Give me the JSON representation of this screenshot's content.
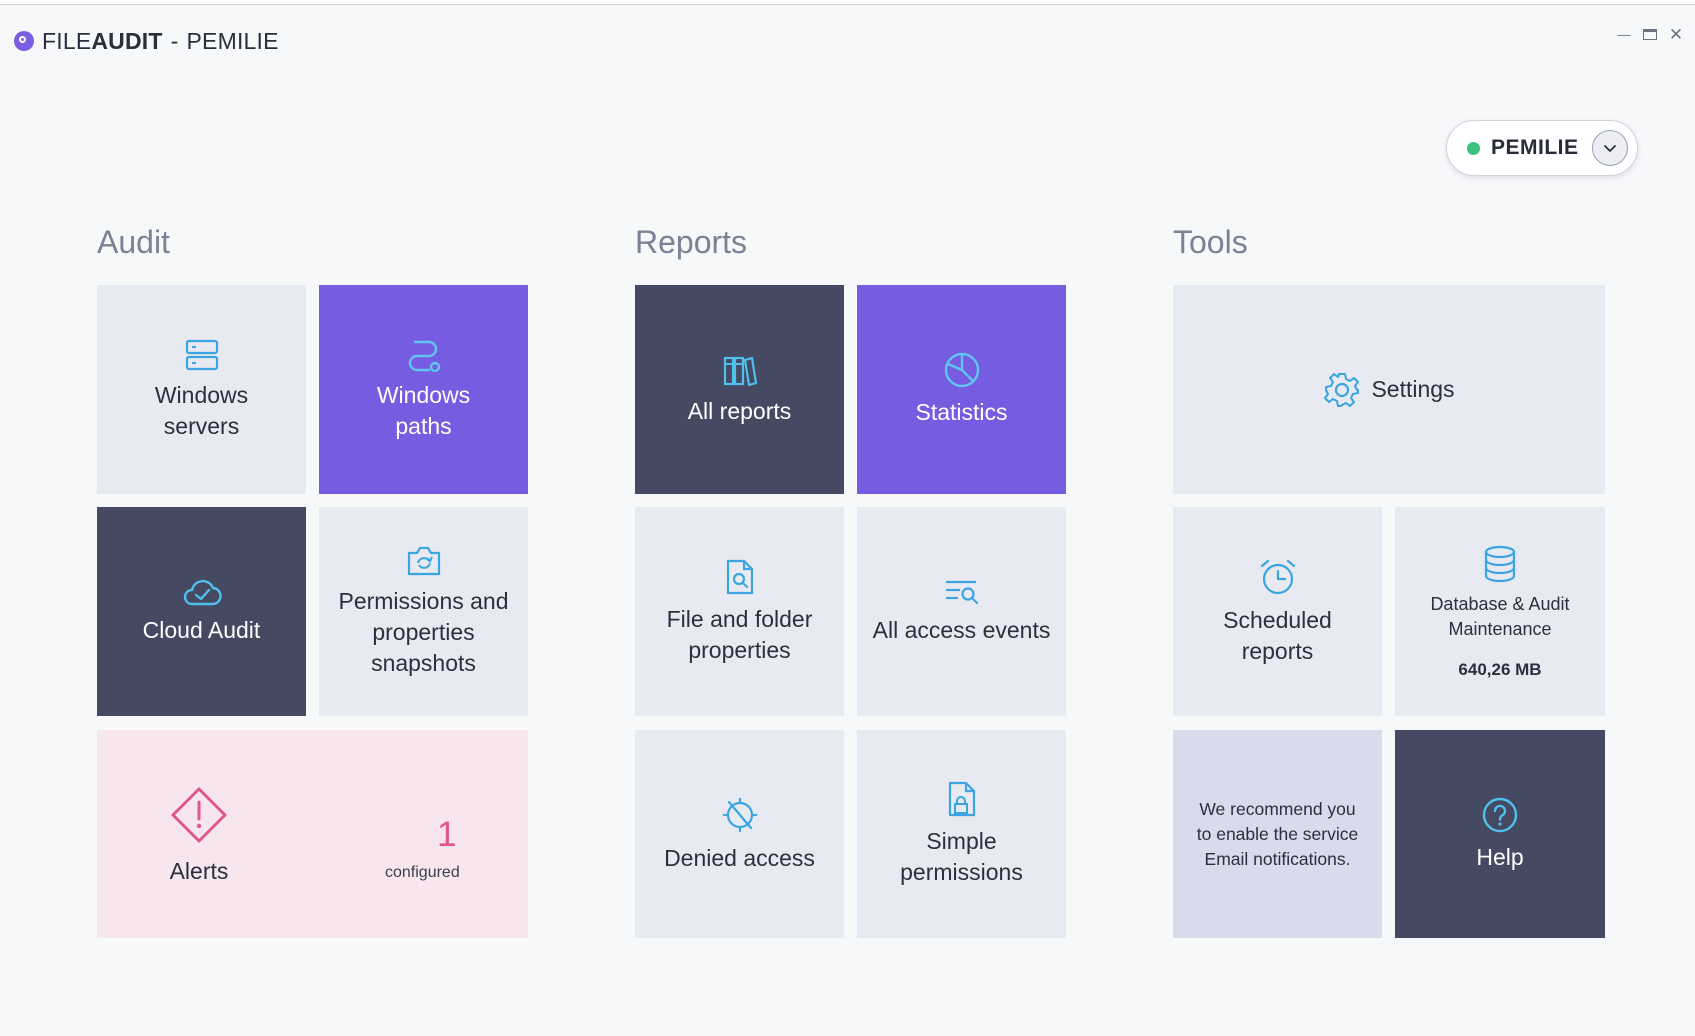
{
  "window": {
    "title_prefix": "FILE",
    "title_bold": "AUDIT",
    "title_sep": "-",
    "title_server": "PEMILIE",
    "controls": {
      "minimize": "—",
      "close": "✕"
    }
  },
  "server_selector": {
    "name": "PEMILIE",
    "status_color": "#3cc17d",
    "icon": "chevron-down-icon"
  },
  "sections": {
    "audit": "Audit",
    "reports": "Reports",
    "tools": "Tools"
  },
  "audit": {
    "windows_servers": {
      "line1": "Windows",
      "line2": "servers",
      "icon": "server-icon"
    },
    "windows_paths": {
      "line1": "Windows",
      "line2": "paths",
      "icon": "route-icon"
    },
    "cloud_audit": {
      "label": "Cloud Audit",
      "icon": "cloud-check-icon"
    },
    "snapshots": {
      "line1": "Permissions and",
      "line2": "properties",
      "line3": "snapshots",
      "icon": "snapshot-icon"
    },
    "alerts": {
      "label": "Alerts",
      "count": "1",
      "count_label": "configured",
      "icon": "warning-diamond-icon"
    }
  },
  "reports": {
    "all_reports": {
      "label": "All reports",
      "icon": "books-icon"
    },
    "statistics": {
      "label": "Statistics",
      "icon": "pie-chart-icon"
    },
    "file_folder": {
      "line1": "File and folder",
      "line2": "properties",
      "icon": "file-search-icon"
    },
    "all_access": {
      "label": "All access events",
      "icon": "list-search-icon"
    },
    "denied": {
      "label": "Denied access",
      "icon": "denied-icon"
    },
    "simple_perms": {
      "line1": "Simple",
      "line2": "permissions",
      "icon": "file-lock-icon"
    }
  },
  "tools": {
    "settings": {
      "label": "Settings",
      "icon": "gear-icon"
    },
    "scheduled": {
      "line1": "Scheduled",
      "line2": "reports",
      "icon": "alarm-clock-icon"
    },
    "database": {
      "line1": "Database & Audit",
      "line2": "Maintenance",
      "size": "640,26 MB",
      "icon": "database-icon"
    },
    "recommend": {
      "line1": "We recommend you",
      "line2": "to enable the service",
      "line3": "Email notifications."
    },
    "help": {
      "label": "Help",
      "icon": "help-circle-icon"
    }
  },
  "colors": {
    "accent_purple": "#765ce0",
    "dark_tile": "#454a62",
    "light_tile": "#e8eaf2",
    "icon_blue": "#3aa5e0",
    "alert_pink": "#e0578a"
  }
}
